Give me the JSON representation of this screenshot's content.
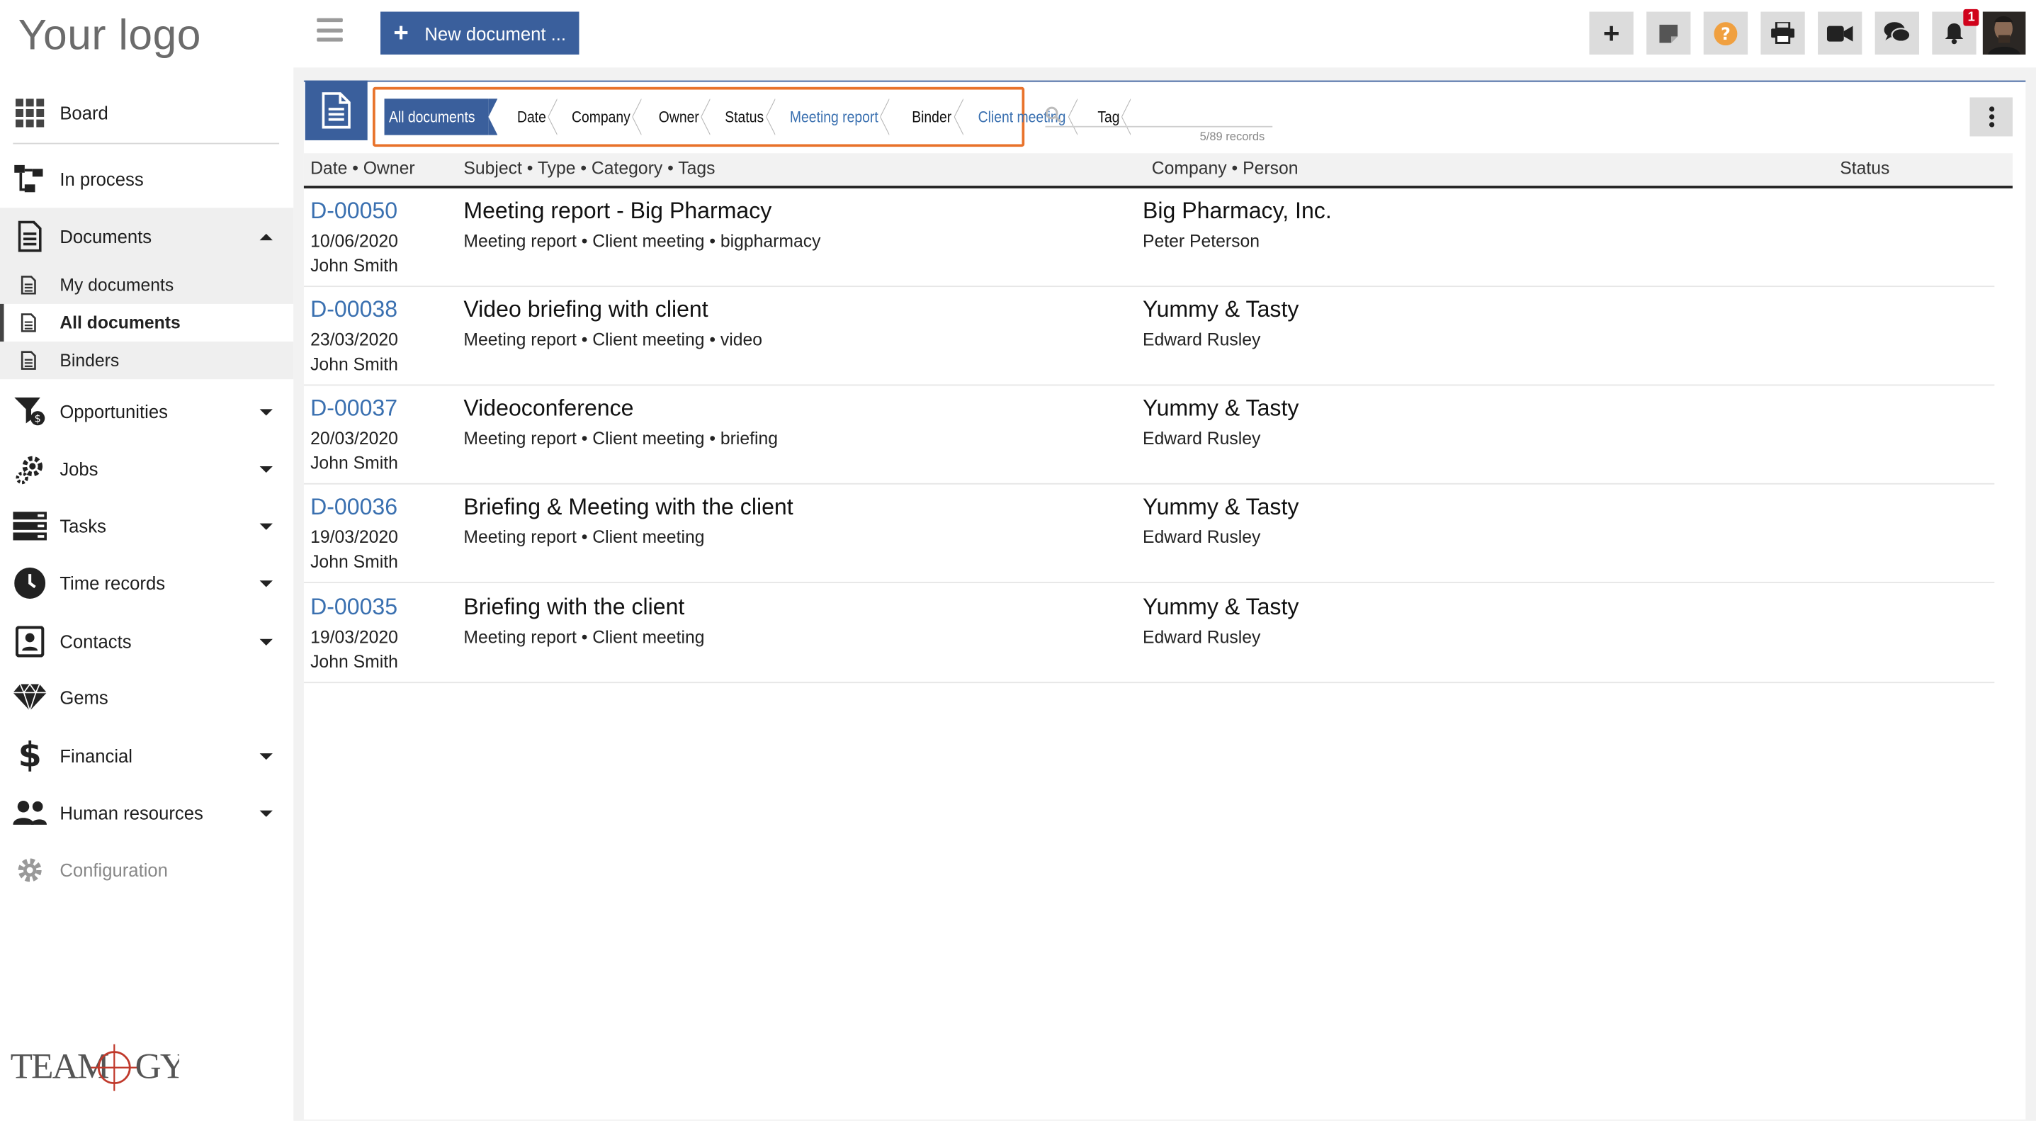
{
  "app": {
    "logo": "Your logo",
    "brand": "TEAMLOGY"
  },
  "topbar": {
    "new_button": "New document ...",
    "notification_count": "1"
  },
  "sidebar": {
    "board": "Board",
    "in_process": "In process",
    "documents": "Documents",
    "sub": {
      "my_documents": "My documents",
      "all_documents": "All documents",
      "binders": "Binders"
    },
    "opportunities": "Opportunities",
    "jobs": "Jobs",
    "tasks": "Tasks",
    "time_records": "Time records",
    "contacts": "Contacts",
    "gems": "Gems",
    "financial": "Financial",
    "human_resources": "Human resources",
    "configuration": "Configuration"
  },
  "filters": {
    "crumbs": [
      "All documents",
      "Date",
      "Company",
      "Owner",
      "Status",
      "Meeting report",
      "Binder",
      "Client meeting",
      "Tag"
    ],
    "records": "5/89 records"
  },
  "table": {
    "headers": {
      "date_owner": "Date • Owner",
      "subject": "Subject • Type • Category • Tags",
      "company": "Company • Person",
      "status": "Status"
    },
    "rows": [
      {
        "code": "D-00050",
        "date": "10/06/2020",
        "owner": "John Smith",
        "subject": "Meeting report - Big Pharmacy",
        "meta": "Meeting report • Client meeting • bigpharmacy",
        "company": "Big Pharmacy, Inc.",
        "person": "Peter Peterson"
      },
      {
        "code": "D-00038",
        "date": "23/03/2020",
        "owner": "John Smith",
        "subject": "Video briefing with client",
        "meta": "Meeting report • Client meeting • video",
        "company": "Yummy & Tasty",
        "person": "Edward Rusley"
      },
      {
        "code": "D-00037",
        "date": "20/03/2020",
        "owner": "John Smith",
        "subject": "Videoconference",
        "meta": "Meeting report • Client meeting • briefing",
        "company": "Yummy & Tasty",
        "person": "Edward Rusley"
      },
      {
        "code": "D-00036",
        "date": "19/03/2020",
        "owner": "John Smith",
        "subject": "Briefing & Meeting with the client",
        "meta": "Meeting report • Client meeting",
        "company": "Yummy & Tasty",
        "person": "Edward Rusley"
      },
      {
        "code": "D-00035",
        "date": "19/03/2020",
        "owner": "John Smith",
        "subject": "Briefing with the client",
        "meta": "Meeting report • Client meeting",
        "company": "Yummy & Tasty",
        "person": "Edward Rusley"
      }
    ]
  },
  "colors": {
    "accent": "#3a5f9c",
    "link": "#3a70b0",
    "highlight": "#e8722a",
    "badge": "#d0021b"
  }
}
